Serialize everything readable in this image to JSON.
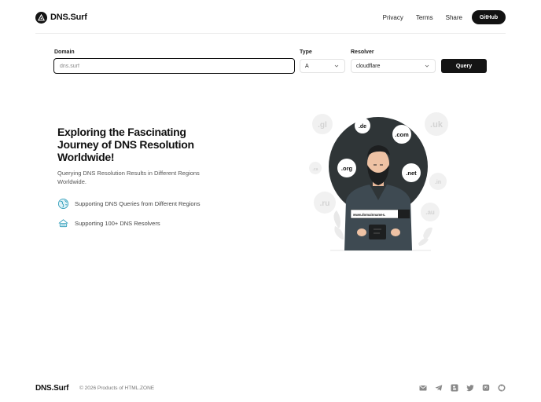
{
  "header": {
    "logo_text_bold": "DNS",
    "logo_text_rest": ".Surf",
    "nav": [
      "Privacy",
      "Terms",
      "Share"
    ],
    "github_label": "GitHub"
  },
  "form": {
    "domain_label": "Domain",
    "domain_value": "dns.surf",
    "type_label": "Type",
    "type_value": "A",
    "resolver_label": "Resolver",
    "resolver_value": "cloudflare",
    "query_label": "Query"
  },
  "hero": {
    "title": "Exploring the Fascinating Journey of DNS Resolution Worldwide!",
    "subtitle": "Querying DNS Resolution Results in Different Regions Worldwide.",
    "features": [
      "Supporting DNS Queries from Different Regions",
      "Supporting 100+ DNS Resolvers"
    ]
  },
  "illustration": {
    "bubbles": [
      ".de",
      ".com",
      ".org",
      ".net"
    ],
    "faded": [
      ".gl",
      ".uk",
      ".ca",
      ".in",
      ".ru",
      ".au"
    ],
    "card_text": "www.domainnames."
  },
  "footer": {
    "logo_text_bold": "DNS",
    "logo_text_rest": ".Surf",
    "copyright": "© 2026 Products of HTML.ZONE",
    "icons": [
      "mail-icon",
      "telegram-icon",
      "blogger-icon",
      "twitter-icon",
      "mastodon-icon",
      "github-icon"
    ]
  },
  "colors": {
    "accent": "#121212",
    "teal": "#2a9bb8",
    "hero_circle": "#2f3537"
  }
}
